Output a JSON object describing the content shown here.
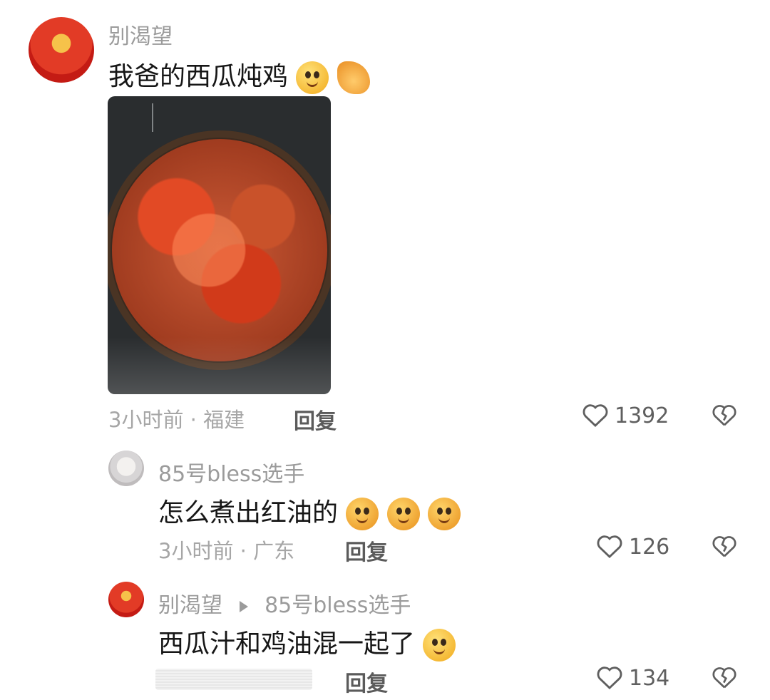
{
  "comments": [
    {
      "username": "别渴望",
      "text": "我爸的西瓜炖鸡",
      "emojis": [
        "smile-emoji",
        "pleading-hand-emoji"
      ],
      "time": "3小时前",
      "location": "福建",
      "reply_label": "回复",
      "likes": "1392",
      "has_photo": true
    },
    {
      "username": "85号bless选手",
      "text": "怎么煮出红油的",
      "emojis": [
        "crying-emoji",
        "crying-emoji",
        "crying-emoji"
      ],
      "time": "3小时前",
      "location": "广东",
      "reply_label": "回复",
      "likes": "126"
    },
    {
      "username": "别渴望",
      "reply_to": "85号bless选手",
      "text": "西瓜汁和鸡油混一起了",
      "emojis": [
        "smile-emoji"
      ],
      "reply_label": "回复",
      "likes": "134"
    }
  ],
  "separator": "·",
  "colors": {
    "text": "#161616",
    "muted": "#9b9b9b",
    "icon": "#5f5f5f"
  }
}
